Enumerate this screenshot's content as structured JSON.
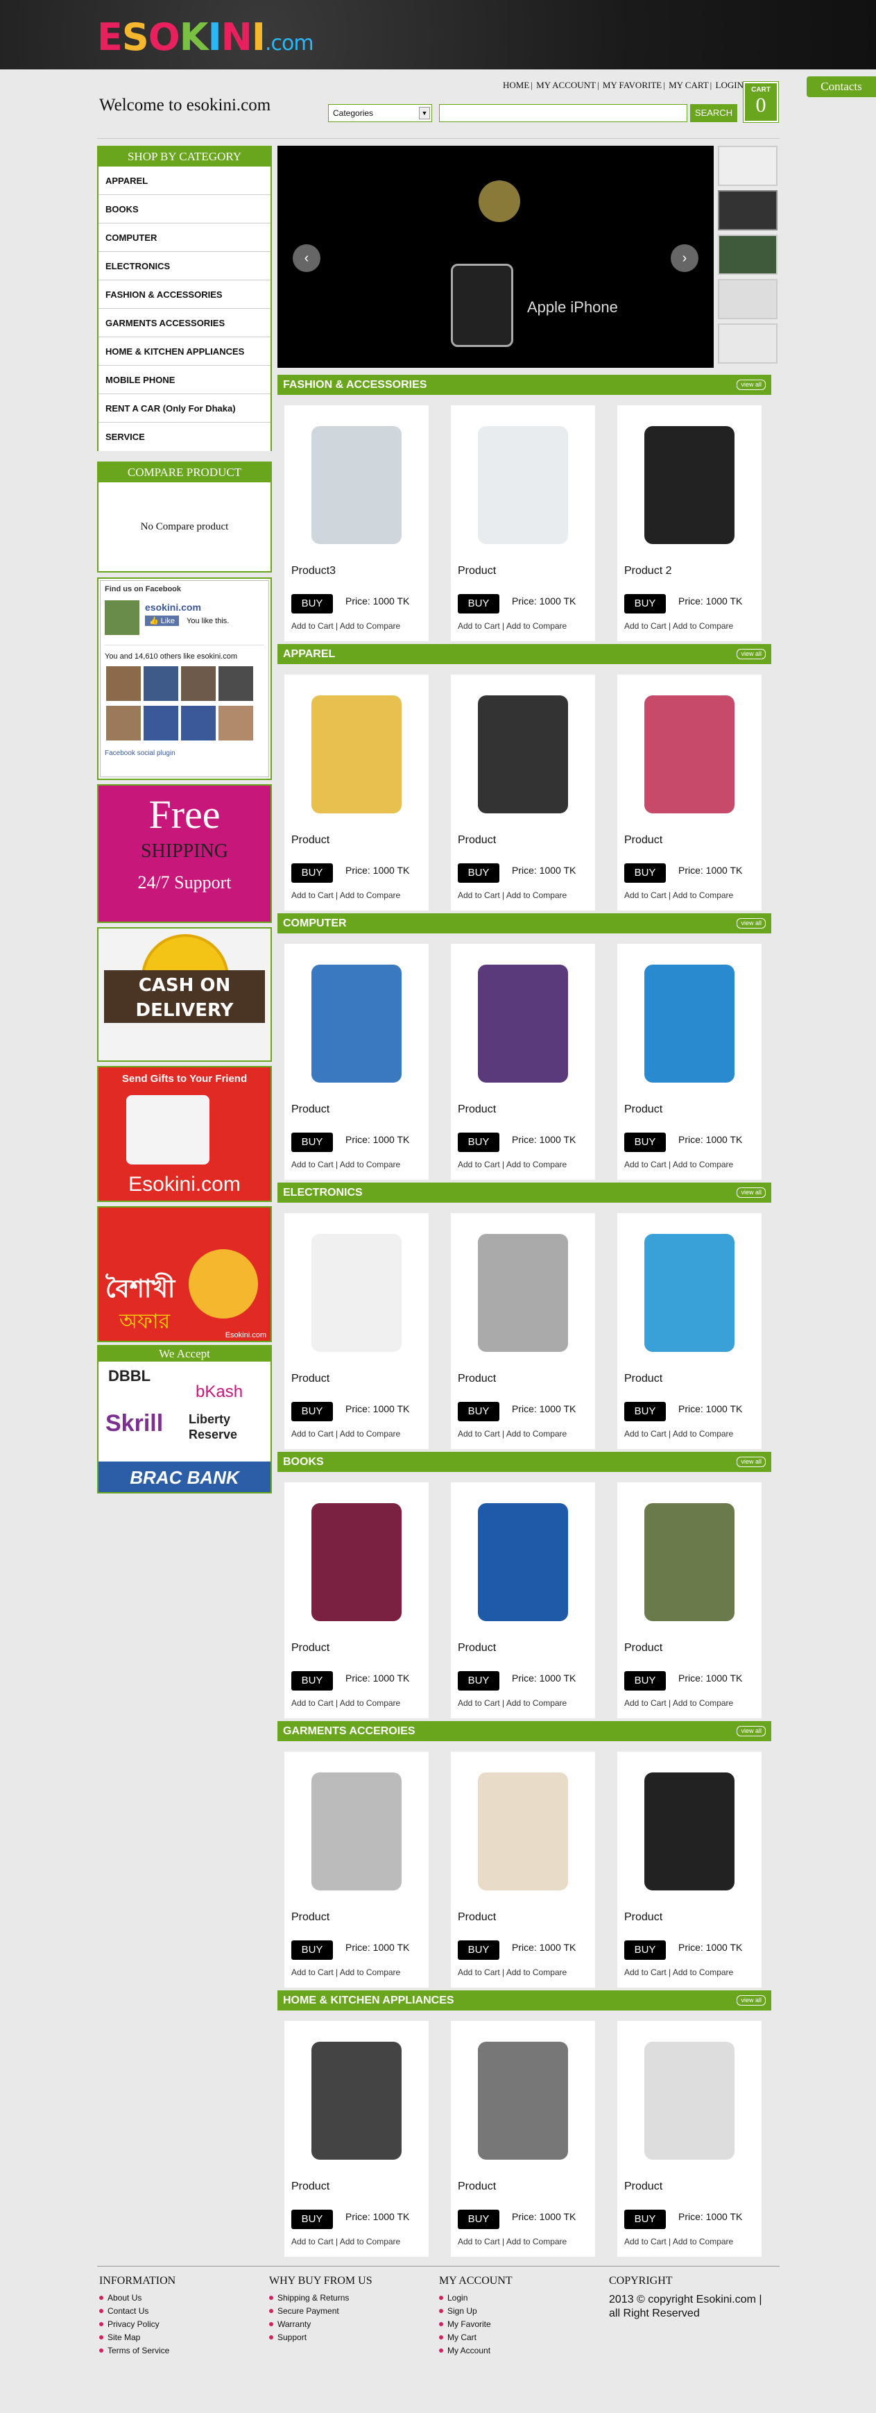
{
  "logo": {
    "text": "ESOKINI",
    "domain": ".com"
  },
  "contacts": "Contacts",
  "welcome": "Welcome to esokini.com",
  "topnav": [
    "HOME",
    "MY ACCOUNT",
    "MY FAVORITE",
    "MY CART",
    "LOGIN"
  ],
  "search": {
    "category": "Categories",
    "button": "SEARCH",
    "placeholder": ""
  },
  "cart": {
    "label": "CART",
    "count": "0"
  },
  "sidebar": {
    "heading": "SHOP BY CATEGORY",
    "categories": [
      "APPAREL",
      "BOOKS",
      "COMPUTER",
      "ELECTRONICS",
      "FASHION & ACCESSORIES",
      "GARMENTS ACCESSORIES",
      "HOME & KITCHEN APPLIANCES",
      "MOBILE PHONE",
      "RENT A CAR (Only For Dhaka)",
      "SERVICE"
    ],
    "compare_heading": "COMPARE PRODUCT",
    "compare_empty": "No Compare product",
    "facebook": {
      "title": "Find us on Facebook",
      "page": "esokini.com",
      "like": "Like",
      "likes_text": "You like this.",
      "friends": "You and 14,610 others like esokini.com",
      "plugin": "Facebook social plugin"
    }
  },
  "ads": {
    "free": {
      "line1": "Free",
      "line2": "SHIPPING",
      "line3": "24/7 Support"
    },
    "cod": {
      "line1": "CASH ON",
      "line2": "DELIVERY"
    },
    "gift": {
      "line1": "Send Gifts to Your Friend",
      "line2": "Esokini.com"
    },
    "boishakh": {
      "line1": "বৈশাখী",
      "line2": "অফার",
      "line3": "Esokini.com"
    },
    "accept": {
      "title": "We Accept",
      "logos": [
        "DBBL",
        "bKash",
        "Skrill",
        "Liberty Reserve",
        "BRAC BANK"
      ]
    }
  },
  "card_labels": {
    "buy": "BUY",
    "add_cart": "Add to Cart",
    "sep": "|",
    "add_compare": "Add to Compare",
    "view_all": "view all"
  },
  "sections": [
    {
      "title": "FASHION & ACCESSORIES",
      "products": [
        {
          "name": "Product3",
          "price": "Price: 1000 TK"
        },
        {
          "name": "Product",
          "price": "Price: 1000 TK"
        },
        {
          "name": "Product 2",
          "price": "Price: 1000 TK"
        }
      ]
    },
    {
      "title": "APPAREL",
      "products": [
        {
          "name": "Product",
          "price": "Price: 1000 TK"
        },
        {
          "name": "Product",
          "price": "Price: 1000 TK"
        },
        {
          "name": "Product",
          "price": "Price: 1000 TK"
        }
      ]
    },
    {
      "title": "COMPUTER",
      "products": [
        {
          "name": "Product",
          "price": "Price: 1000 TK"
        },
        {
          "name": "Product",
          "price": "Price: 1000 TK"
        },
        {
          "name": "Product",
          "price": "Price: 1000 TK"
        }
      ]
    },
    {
      "title": "ELECTRONICS",
      "products": [
        {
          "name": "Product",
          "price": "Price: 1000 TK"
        },
        {
          "name": "Product",
          "price": "Price: 1000 TK"
        },
        {
          "name": "Product",
          "price": "Price: 1000 TK"
        }
      ]
    },
    {
      "title": "BOOKS",
      "products": [
        {
          "name": "Product",
          "price": "Price: 1000 TK"
        },
        {
          "name": "Product",
          "price": "Price: 1000 TK"
        },
        {
          "name": "Product",
          "price": "Price: 1000 TK"
        }
      ]
    },
    {
      "title": "GARMENTS ACCEROIES",
      "products": [
        {
          "name": "Product",
          "price": "Price: 1000 TK"
        },
        {
          "name": "Product",
          "price": "Price: 1000 TK"
        },
        {
          "name": "Product",
          "price": "Price: 1000 TK"
        }
      ]
    },
    {
      "title": "HOME & KITCHEN APPLIANCES",
      "products": [
        {
          "name": "Product",
          "price": "Price: 1000 TK"
        },
        {
          "name": "Product",
          "price": "Price: 1000 TK"
        },
        {
          "name": "Product",
          "price": "Price: 1000 TK"
        }
      ]
    }
  ],
  "slider": {
    "caption": "Apple iPhone"
  },
  "footer": {
    "info": {
      "title": "INFORMATION",
      "items": [
        "About Us",
        "Contact Us",
        "Privacy Policy",
        "Site Map",
        "Terms of Service"
      ]
    },
    "why": {
      "title": "WHY BUY FROM US",
      "items": [
        "Shipping & Returns",
        "Secure Payment",
        "Warranty",
        "Support"
      ]
    },
    "account": {
      "title": "MY ACCOUNT",
      "items": [
        "Login",
        "Sign Up",
        "My Favorite",
        "My Cart",
        "My Account"
      ]
    },
    "copyright": {
      "title": "COPYRIGHT",
      "text": "2013 © copyright Esokini.com | all Right Reserved"
    }
  },
  "colors": {
    "accent": "#6aa51e",
    "ad_pink": "#c8177a",
    "ad_red": "#e12a24"
  }
}
